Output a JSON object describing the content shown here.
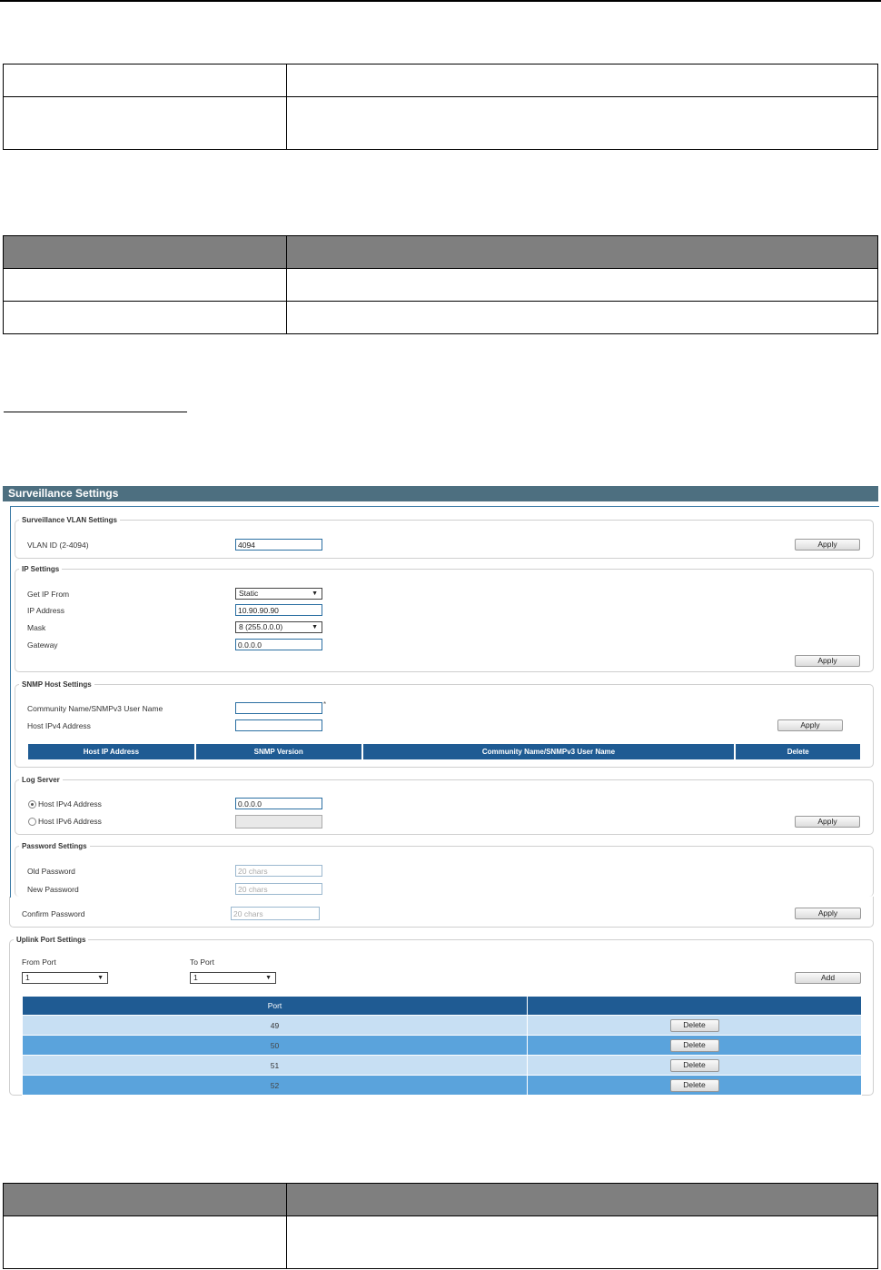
{
  "surveillance": {
    "title": "Surveillance Settings",
    "vlan": {
      "legend": "Surveillance VLAN Settings",
      "vlan_id_label": "VLAN ID (2-4094)",
      "vlan_id_value": "4094",
      "apply_label": "Apply"
    },
    "ip": {
      "legend": "IP Settings",
      "get_ip_label": "Get IP From",
      "get_ip_value": "Static",
      "ip_label": "IP Address",
      "ip_value": "10.90.90.90",
      "mask_label": "Mask",
      "mask_value": "8 (255.0.0.0)",
      "gateway_label": "Gateway",
      "gateway_value": "0.0.0.0",
      "apply_label": "Apply"
    },
    "snmp": {
      "legend": "SNMP Host Settings",
      "community_label": "Community Name/SNMPv3 User Name",
      "required_mark": "*",
      "host_ipv4_label": "Host IPv4 Address",
      "apply_label": "Apply",
      "columns": [
        "Host IP Address",
        "SNMP Version",
        "Community Name/SNMPv3 User Name",
        "Delete"
      ]
    },
    "log": {
      "legend": "Log Server",
      "ipv4_label": "Host IPv4 Address",
      "ipv4_value": "0.0.0.0",
      "ipv6_label": "Host IPv6 Address",
      "selected": "ipv4",
      "apply_label": "Apply"
    },
    "password": {
      "legend": "Password Settings",
      "old_label": "Old Password",
      "new_label": "New Password",
      "confirm_label": "Confirm Password",
      "placeholder": "20 chars",
      "apply_label": "Apply"
    },
    "uplink": {
      "legend": "Uplink Port Settings",
      "from_label": "From Port",
      "from_value": "1",
      "to_label": "To Port",
      "to_value": "1",
      "add_label": "Add",
      "port_header": "Port",
      "action_header": "",
      "delete_label": "Delete",
      "ports": [
        "49",
        "50",
        "51",
        "52"
      ]
    }
  },
  "colors": {
    "titlebar": "#4d6f80",
    "table_header": "#1f5b93",
    "row_light": "#c7dff3",
    "row_dark": "#5aa3dc",
    "doc_header": "#7f7f7f"
  }
}
